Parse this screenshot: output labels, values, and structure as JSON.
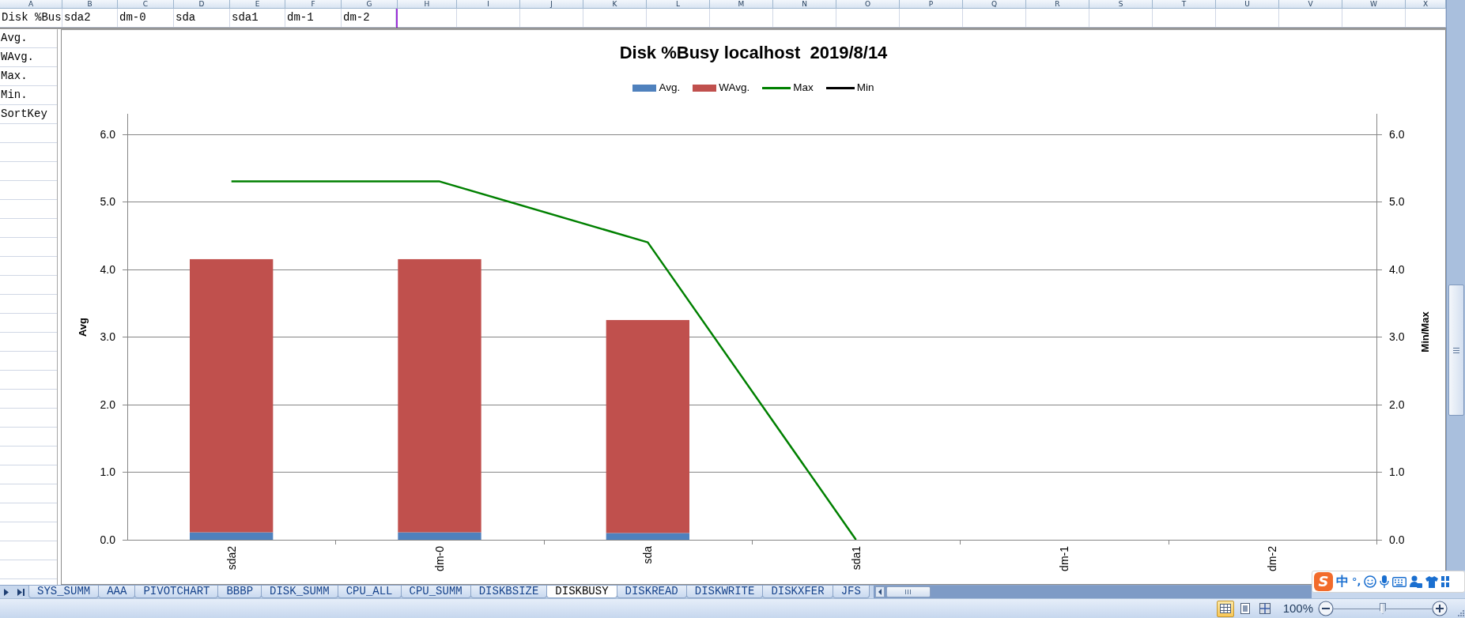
{
  "spreadsheet": {
    "columns": [
      "A",
      "B",
      "C",
      "D",
      "E",
      "F",
      "G",
      "H",
      "I",
      "J",
      "K",
      "L",
      "M",
      "N",
      "O",
      "P",
      "Q",
      "R",
      "S",
      "T",
      "U",
      "V",
      "W",
      "X"
    ],
    "row_1": [
      "Disk %Bus",
      "sda2",
      "dm-0",
      "sda",
      "sda1",
      "dm-1",
      "dm-2"
    ],
    "column_a": [
      "Avg.",
      "WAvg.",
      "Max.",
      "Min.",
      "SortKey"
    ]
  },
  "chart": {
    "chart_data": {
      "type": "bar",
      "title": "Disk %Busy localhost  2019/8/14",
      "ylabel": "Avg",
      "y2label": "Min/Max",
      "legend": true,
      "grid": true,
      "categories": [
        "sda2",
        "dm-0",
        "sda",
        "sda1",
        "dm-1",
        "dm-2"
      ],
      "series": [
        {
          "name": "Avg.",
          "type": "bar",
          "color": "#4f81bd",
          "values": [
            0.11,
            0.11,
            0.1,
            0,
            0,
            0
          ]
        },
        {
          "name": "WAvg.",
          "type": "bar",
          "color": "#c0504d",
          "values": [
            4.04,
            4.04,
            3.15,
            0,
            0,
            0
          ]
        },
        {
          "name": "Max",
          "type": "line",
          "color": "#008000",
          "values": [
            5.3,
            5.3,
            4.4,
            0,
            null,
            null
          ]
        },
        {
          "name": "Min",
          "type": "line",
          "color": "#000000",
          "values": [
            null,
            null,
            null,
            null,
            null,
            null
          ]
        }
      ],
      "stacked": true,
      "ylim": [
        0,
        6.3
      ],
      "y2lim": [
        0,
        6.3
      ],
      "yticks": [
        {
          "value": 0,
          "label": "0.0"
        },
        {
          "value": 1,
          "label": "1.0"
        },
        {
          "value": 2,
          "label": "2.0"
        },
        {
          "value": 3,
          "label": "3.0"
        },
        {
          "value": 4,
          "label": "4.0"
        },
        {
          "value": 5,
          "label": "5.0"
        },
        {
          "value": 6,
          "label": "6.0"
        }
      ],
      "y2ticks": [
        {
          "value": 0,
          "label": "0.0"
        },
        {
          "value": 1,
          "label": "1.0"
        },
        {
          "value": 2,
          "label": "2.0"
        },
        {
          "value": 3,
          "label": "3.0"
        },
        {
          "value": 4,
          "label": "4.0"
        },
        {
          "value": 5,
          "label": "5.0"
        },
        {
          "value": 6,
          "label": "6.0"
        }
      ]
    }
  },
  "sheet_tabs": [
    {
      "label": "SYS_SUMM",
      "selected": false
    },
    {
      "label": "AAA",
      "selected": false
    },
    {
      "label": "PIVOTCHART",
      "selected": false
    },
    {
      "label": "BBBP",
      "selected": false
    },
    {
      "label": "DISK_SUMM",
      "selected": false
    },
    {
      "label": "CPU_ALL",
      "selected": false
    },
    {
      "label": "CPU_SUMM",
      "selected": false
    },
    {
      "label": "DISKBSIZE",
      "selected": false
    },
    {
      "label": "DISKBUSY",
      "selected": true
    },
    {
      "label": "DISKREAD",
      "selected": false
    },
    {
      "label": "DISKWRITE",
      "selected": false
    },
    {
      "label": "DISKXFER",
      "selected": false
    },
    {
      "label": "JFS",
      "selected": false
    }
  ],
  "status_bar": {
    "view_buttons": [
      {
        "kind": "normal",
        "selected": true
      },
      {
        "kind": "page_layout",
        "selected": false
      },
      {
        "kind": "page_break",
        "selected": false
      }
    ],
    "zoom": {
      "label": "100%",
      "level": 0.5
    }
  },
  "ime_toolbar": {
    "logo": "S",
    "mode": "中",
    "punctuation": "°,"
  }
}
